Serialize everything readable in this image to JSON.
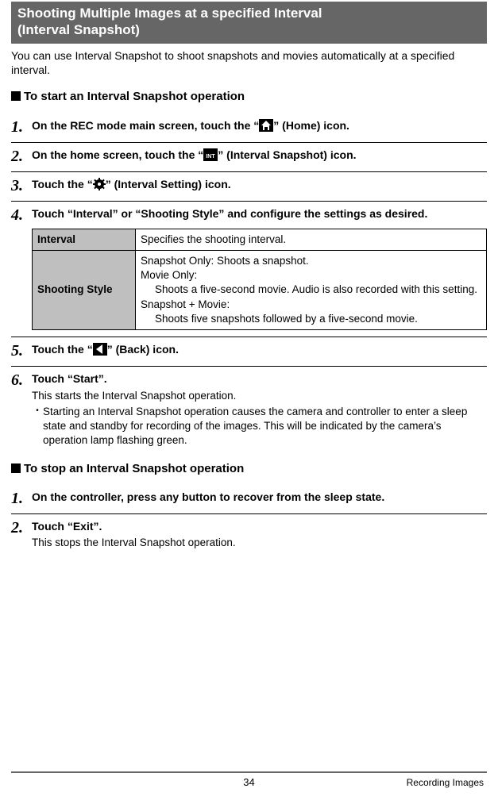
{
  "header": {
    "title_line1": "Shooting Multiple Images at a specified Interval",
    "title_line2": "(Interval Snapshot)"
  },
  "intro": "You can use Interval Snapshot to shoot snapshots and movies automatically at a specified interval.",
  "section_start": {
    "heading": "To start an Interval Snapshot operation",
    "steps": {
      "s1": {
        "pre": "On the REC mode main screen, touch the “",
        "post": "” (Home) icon."
      },
      "s2": {
        "pre": "On the home screen, touch the “",
        "post": "” (Interval Snapshot) icon."
      },
      "s3": {
        "pre": "Touch the “",
        "post": "” (Interval Setting) icon."
      },
      "s4": {
        "title": "Touch “Interval” or “Shooting Style” and configure the settings as desired.",
        "table": {
          "interval_key": "Interval",
          "interval_val": "Specifies the shooting interval.",
          "style_key": "Shooting Style",
          "style_line1": "Snapshot Only: Shoots a snapshot.",
          "style_line2": "Movie Only:",
          "style_line2_sub": "Shoots a five-second movie. Audio is also recorded with this setting.",
          "style_line3": "Snapshot + Movie:",
          "style_line3_sub": "Shoots five snapshots followed by a five-second movie."
        }
      },
      "s5": {
        "pre": "Touch the “",
        "post": "” (Back) icon."
      },
      "s6": {
        "title": "Touch “Start”.",
        "desc": "This starts the Interval Snapshot operation.",
        "bullet": "Starting an Interval Snapshot operation causes the camera and controller to enter a sleep state and standby for recording of the images. This will be indicated by the camera’s operation lamp flashing green."
      }
    }
  },
  "section_stop": {
    "heading": "To stop an Interval Snapshot operation",
    "steps": {
      "s1": "On the controller, press any button to recover from the sleep state.",
      "s2_title": "Touch “Exit”.",
      "s2_desc": "This stops the Interval Snapshot operation."
    }
  },
  "footer": {
    "page": "34",
    "chapter": "Recording Images"
  }
}
